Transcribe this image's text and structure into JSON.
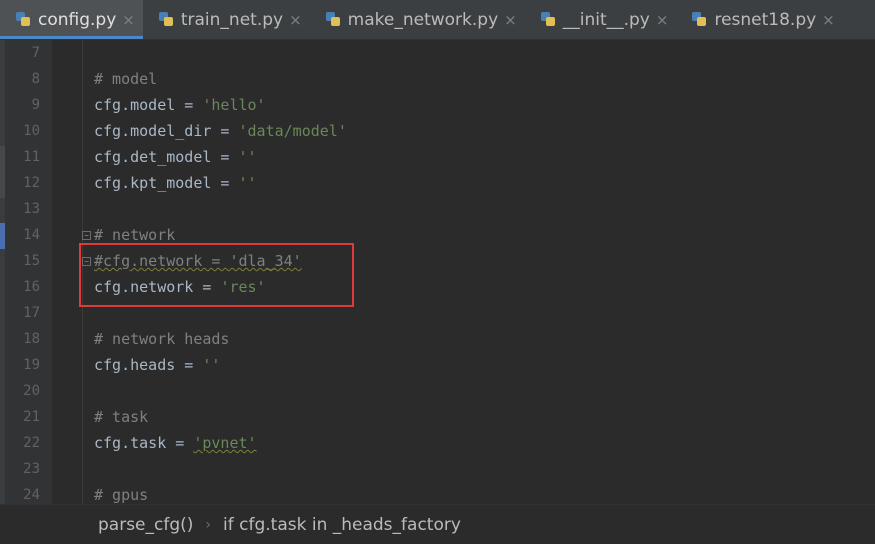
{
  "tabs": [
    {
      "label": "config.py",
      "active": true
    },
    {
      "label": "train_net.py",
      "active": false
    },
    {
      "label": "make_network.py",
      "active": false
    },
    {
      "label": "__init__.py",
      "active": false
    },
    {
      "label": "resnet18.py",
      "active": false
    }
  ],
  "editor": {
    "lines": [
      {
        "n": "7"
      },
      {
        "n": "8",
        "comment": "# model"
      },
      {
        "n": "9",
        "code": "cfg.model = ",
        "str": "'hello'"
      },
      {
        "n": "10",
        "code": "cfg.model_dir = ",
        "str": "'data/model'"
      },
      {
        "n": "11",
        "code": "cfg.det_model = ",
        "str": "''"
      },
      {
        "n": "12",
        "code": "cfg.kpt_model = ",
        "str": "''"
      },
      {
        "n": "13"
      },
      {
        "n": "14",
        "comment": "# network"
      },
      {
        "n": "15",
        "comment": "#cfg.network = 'dla_34'"
      },
      {
        "n": "16",
        "code": "cfg.network = ",
        "str": "'res'"
      },
      {
        "n": "17"
      },
      {
        "n": "18",
        "comment": "# network heads"
      },
      {
        "n": "19",
        "code": "cfg.heads = ",
        "str": "''"
      },
      {
        "n": "20"
      },
      {
        "n": "21",
        "comment": "# task"
      },
      {
        "n": "22",
        "code": "cfg.task = ",
        "str": "'pvnet'"
      },
      {
        "n": "23"
      },
      {
        "n": "24",
        "comment": "# gpus"
      }
    ]
  },
  "breadcrumb": {
    "items": [
      "parse_cfg()",
      "if cfg.task in _heads_factory"
    ],
    "separator": "›"
  },
  "colors": {
    "background": "#2b2b2b",
    "comment": "#808080",
    "string": "#6a8759",
    "code": "#a9b7c6",
    "highlight": "#e03b3b",
    "accent": "#4a88c7"
  }
}
